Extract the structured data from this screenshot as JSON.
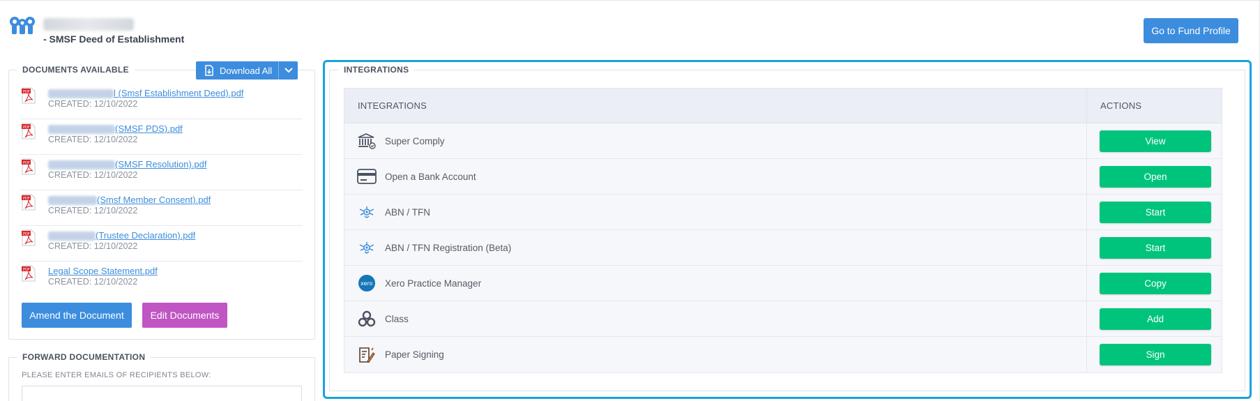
{
  "header": {
    "deed_title": "- SMSF Deed of Establishment",
    "fund_profile_button": "Go to Fund Profile"
  },
  "documents": {
    "legend": "DOCUMENTS AVAILABLE",
    "download_all_label": "Download All",
    "items": [
      {
        "name_suffix": "l (Smsf Establishment Deed).pdf",
        "created": "CREATED: 12/10/2022"
      },
      {
        "name_suffix": "(SMSF PDS).pdf",
        "created": "CREATED: 12/10/2022"
      },
      {
        "name_suffix": "(SMSF Resolution).pdf",
        "created": "CREATED: 12/10/2022"
      },
      {
        "name_suffix": "(Smsf Member Consent).pdf",
        "created": "CREATED: 12/10/2022"
      },
      {
        "name_suffix": "(Trustee Declaration).pdf",
        "created": "CREATED: 12/10/2022"
      },
      {
        "name_suffix": "Legal Scope Statement.pdf",
        "created": "CREATED: 12/10/2022"
      }
    ],
    "amend_button": "Amend the Document",
    "edit_button": "Edit Documents"
  },
  "forward": {
    "legend": "FORWARD DOCUMENTATION",
    "label": "PLEASE ENTER EMAILS OF RECIPIENTS BELOW:"
  },
  "integrations": {
    "legend": "INTEGRATIONS",
    "col_name": "INTEGRATIONS",
    "col_actions": "ACTIONS",
    "rows": [
      {
        "label": "Super Comply",
        "action": "View",
        "icon": "bank-icon"
      },
      {
        "label": "Open a Bank Account",
        "action": "Open",
        "icon": "card-icon"
      },
      {
        "label": "ABN / TFN",
        "action": "Start",
        "icon": "coat-of-arms-icon"
      },
      {
        "label": "ABN / TFN Registration (Beta)",
        "action": "Start",
        "icon": "coat-of-arms-icon"
      },
      {
        "label": "Xero Practice Manager",
        "action": "Copy",
        "icon": "xero-icon"
      },
      {
        "label": "Class",
        "action": "Add",
        "icon": "class-icon"
      },
      {
        "label": "Paper Signing",
        "action": "Sign",
        "icon": "paper-sign-icon"
      }
    ],
    "colors": {
      "action_green": "#00c47c",
      "focus_blue": "#1aa2dd"
    }
  },
  "colors": {
    "primary_blue": "#3c8dde",
    "edit_purple": "#c055c3"
  }
}
